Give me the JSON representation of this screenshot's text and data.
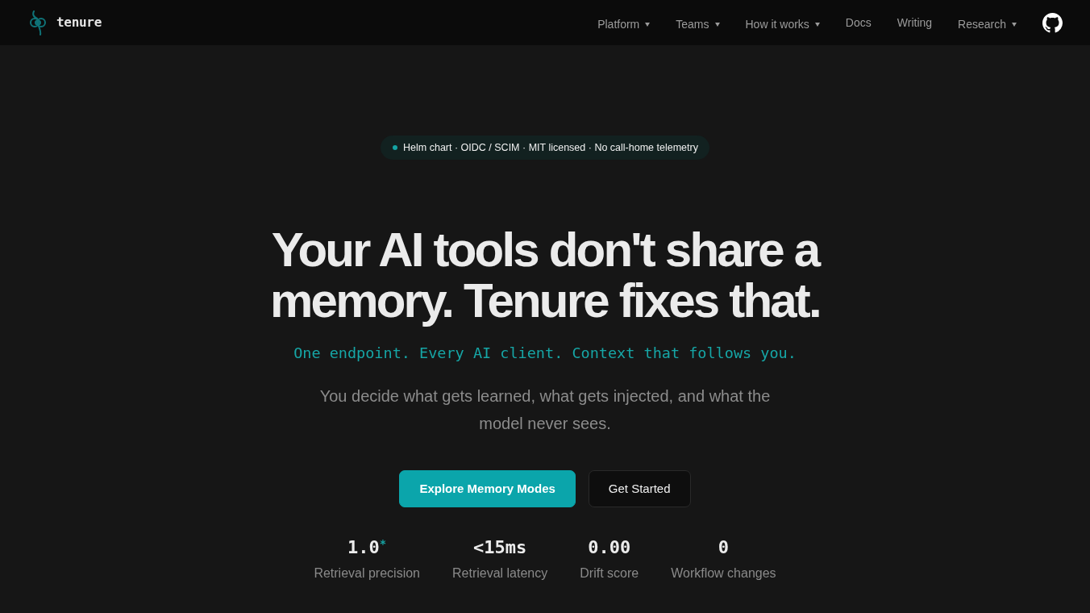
{
  "nav": {
    "logo": {
      "text": "tenure"
    },
    "links": [
      {
        "label": "Platform",
        "dropdown": true
      },
      {
        "label": "Teams",
        "dropdown": true
      },
      {
        "label": "How it works",
        "dropdown": true
      },
      {
        "label": "Docs",
        "dropdown": false
      },
      {
        "label": "Writing",
        "dropdown": false
      },
      {
        "label": "Research",
        "dropdown": true
      }
    ]
  },
  "hero": {
    "badge": {
      "text": "Helm chart · OIDC / SCIM · MIT licensed · No call-home telemetry"
    },
    "headline": "Your AI tools don't share a memory. Tenure fixes that.",
    "tagline": "One endpoint. Every AI client. Context that follows you.",
    "description": "You decide what gets learned, what gets injected, and what the model never sees.",
    "buttons": [
      {
        "label": "Explore Memory Modes",
        "kind": "primary"
      },
      {
        "label": "Get Started",
        "kind": "secondary"
      }
    ],
    "stats": [
      {
        "value": "1.0$^{*}$",
        "label": "Retrieval precision"
      },
      {
        "value": "<15ms",
        "label": "Retrieval latency"
      },
      {
        "value": "0.00",
        "label": "Drift score"
      },
      {
        "value": "0",
        "label": "Workflow changes"
      }
    ]
  }
}
